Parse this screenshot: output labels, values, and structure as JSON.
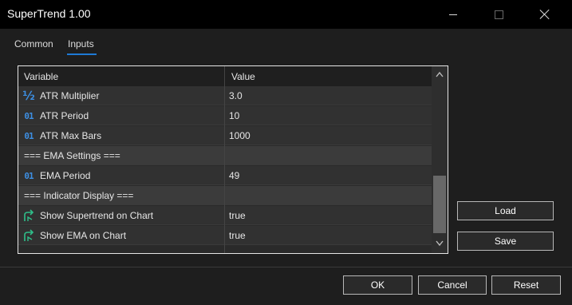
{
  "window": {
    "title": "SuperTrend 1.00",
    "controls": [
      "minimize",
      "maximize",
      "close"
    ]
  },
  "tabs": [
    {
      "label": "Common",
      "active": false
    },
    {
      "label": "Inputs",
      "active": true
    }
  ],
  "table": {
    "headers": {
      "variable": "Variable",
      "value": "Value"
    },
    "rows": [
      {
        "icon": "fraction-icon",
        "variable": "ATR Multiplier",
        "value": "3.0",
        "type": "param"
      },
      {
        "icon": "integer-icon",
        "variable": "ATR Period",
        "value": "10",
        "type": "param"
      },
      {
        "icon": "integer-icon",
        "variable": "ATR Max Bars",
        "value": "1000",
        "type": "param"
      },
      {
        "icon": "",
        "variable": "=== EMA Settings ===",
        "value": "",
        "type": "section"
      },
      {
        "icon": "integer-icon",
        "variable": "EMA Period",
        "value": "49",
        "type": "param"
      },
      {
        "icon": "",
        "variable": "=== Indicator Display ===",
        "value": "",
        "type": "section"
      },
      {
        "icon": "boolean-arrow-icon",
        "variable": "Show Supertrend on Chart",
        "value": "true",
        "type": "param"
      },
      {
        "icon": "boolean-arrow-icon",
        "variable": "Show EMA on Chart",
        "value": "true",
        "type": "param"
      }
    ]
  },
  "side_buttons": {
    "load": "Load",
    "save": "Save"
  },
  "footer_buttons": {
    "ok": "OK",
    "cancel": "Cancel",
    "reset": "Reset"
  },
  "icon_glyphs": {
    "fraction": "½",
    "integer": "01"
  },
  "colors": {
    "accent": "#1e7ad6",
    "icon_blue": "#3d8fe3",
    "icon_green": "#2fbf8a"
  }
}
